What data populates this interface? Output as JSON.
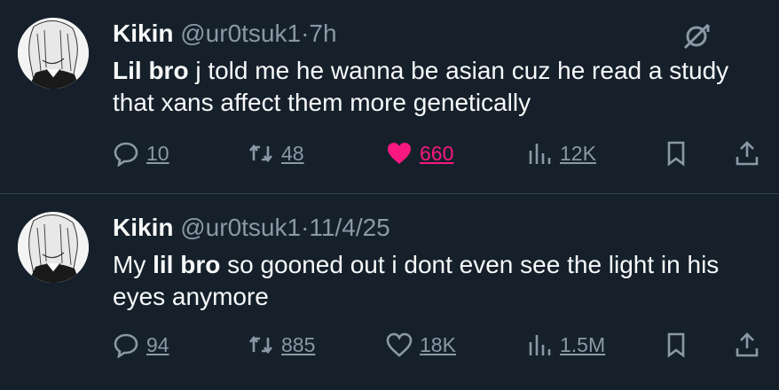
{
  "tweets": [
    {
      "name": "Kikin",
      "handle": "@ur0tsuk1",
      "separator": "·",
      "time": "7h",
      "text_bold": "Lil bro",
      "text_rest": " j told me he wanna be asian cuz he read a study that xans affect them more genetically",
      "replies": "10",
      "reposts": "48",
      "likes": "660",
      "views": "12K",
      "liked": true
    },
    {
      "name": "Kikin",
      "handle": "@ur0tsuk1",
      "separator": "·",
      "time": "11/4/25",
      "text_pre": "My ",
      "text_bold": "lil bro",
      "text_rest": " so gooned out i dont even see the light in his eyes anymore",
      "replies": "94",
      "reposts": "885",
      "likes": "18K",
      "views": "1.5M",
      "liked": false
    }
  ],
  "colors": {
    "background": "#15202b",
    "text": "#f7f9f9",
    "muted": "#8b98a5",
    "like": "#f91880",
    "divider": "#38444d"
  },
  "icons": [
    "avatar",
    "grok-icon",
    "reply-icon",
    "repost-icon",
    "like-icon",
    "views-icon",
    "bookmark-icon",
    "share-icon"
  ]
}
